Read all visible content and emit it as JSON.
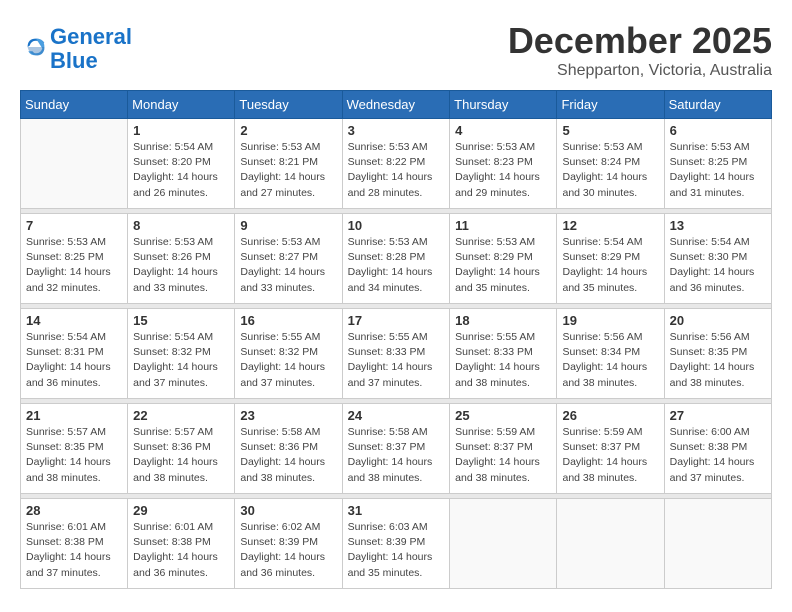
{
  "header": {
    "logo_line1": "General",
    "logo_line2": "Blue",
    "month": "December 2025",
    "location": "Shepparton, Victoria, Australia"
  },
  "calendar": {
    "days_of_week": [
      "Sunday",
      "Monday",
      "Tuesday",
      "Wednesday",
      "Thursday",
      "Friday",
      "Saturday"
    ],
    "weeks": [
      [
        {
          "day": "",
          "info": ""
        },
        {
          "day": "1",
          "info": "Sunrise: 5:54 AM\nSunset: 8:20 PM\nDaylight: 14 hours\nand 26 minutes."
        },
        {
          "day": "2",
          "info": "Sunrise: 5:53 AM\nSunset: 8:21 PM\nDaylight: 14 hours\nand 27 minutes."
        },
        {
          "day": "3",
          "info": "Sunrise: 5:53 AM\nSunset: 8:22 PM\nDaylight: 14 hours\nand 28 minutes."
        },
        {
          "day": "4",
          "info": "Sunrise: 5:53 AM\nSunset: 8:23 PM\nDaylight: 14 hours\nand 29 minutes."
        },
        {
          "day": "5",
          "info": "Sunrise: 5:53 AM\nSunset: 8:24 PM\nDaylight: 14 hours\nand 30 minutes."
        },
        {
          "day": "6",
          "info": "Sunrise: 5:53 AM\nSunset: 8:25 PM\nDaylight: 14 hours\nand 31 minutes."
        }
      ],
      [
        {
          "day": "7",
          "info": "Sunrise: 5:53 AM\nSunset: 8:25 PM\nDaylight: 14 hours\nand 32 minutes."
        },
        {
          "day": "8",
          "info": "Sunrise: 5:53 AM\nSunset: 8:26 PM\nDaylight: 14 hours\nand 33 minutes."
        },
        {
          "day": "9",
          "info": "Sunrise: 5:53 AM\nSunset: 8:27 PM\nDaylight: 14 hours\nand 33 minutes."
        },
        {
          "day": "10",
          "info": "Sunrise: 5:53 AM\nSunset: 8:28 PM\nDaylight: 14 hours\nand 34 minutes."
        },
        {
          "day": "11",
          "info": "Sunrise: 5:53 AM\nSunset: 8:29 PM\nDaylight: 14 hours\nand 35 minutes."
        },
        {
          "day": "12",
          "info": "Sunrise: 5:54 AM\nSunset: 8:29 PM\nDaylight: 14 hours\nand 35 minutes."
        },
        {
          "day": "13",
          "info": "Sunrise: 5:54 AM\nSunset: 8:30 PM\nDaylight: 14 hours\nand 36 minutes."
        }
      ],
      [
        {
          "day": "14",
          "info": "Sunrise: 5:54 AM\nSunset: 8:31 PM\nDaylight: 14 hours\nand 36 minutes."
        },
        {
          "day": "15",
          "info": "Sunrise: 5:54 AM\nSunset: 8:32 PM\nDaylight: 14 hours\nand 37 minutes."
        },
        {
          "day": "16",
          "info": "Sunrise: 5:55 AM\nSunset: 8:32 PM\nDaylight: 14 hours\nand 37 minutes."
        },
        {
          "day": "17",
          "info": "Sunrise: 5:55 AM\nSunset: 8:33 PM\nDaylight: 14 hours\nand 37 minutes."
        },
        {
          "day": "18",
          "info": "Sunrise: 5:55 AM\nSunset: 8:33 PM\nDaylight: 14 hours\nand 38 minutes."
        },
        {
          "day": "19",
          "info": "Sunrise: 5:56 AM\nSunset: 8:34 PM\nDaylight: 14 hours\nand 38 minutes."
        },
        {
          "day": "20",
          "info": "Sunrise: 5:56 AM\nSunset: 8:35 PM\nDaylight: 14 hours\nand 38 minutes."
        }
      ],
      [
        {
          "day": "21",
          "info": "Sunrise: 5:57 AM\nSunset: 8:35 PM\nDaylight: 14 hours\nand 38 minutes."
        },
        {
          "day": "22",
          "info": "Sunrise: 5:57 AM\nSunset: 8:36 PM\nDaylight: 14 hours\nand 38 minutes."
        },
        {
          "day": "23",
          "info": "Sunrise: 5:58 AM\nSunset: 8:36 PM\nDaylight: 14 hours\nand 38 minutes."
        },
        {
          "day": "24",
          "info": "Sunrise: 5:58 AM\nSunset: 8:37 PM\nDaylight: 14 hours\nand 38 minutes."
        },
        {
          "day": "25",
          "info": "Sunrise: 5:59 AM\nSunset: 8:37 PM\nDaylight: 14 hours\nand 38 minutes."
        },
        {
          "day": "26",
          "info": "Sunrise: 5:59 AM\nSunset: 8:37 PM\nDaylight: 14 hours\nand 38 minutes."
        },
        {
          "day": "27",
          "info": "Sunrise: 6:00 AM\nSunset: 8:38 PM\nDaylight: 14 hours\nand 37 minutes."
        }
      ],
      [
        {
          "day": "28",
          "info": "Sunrise: 6:01 AM\nSunset: 8:38 PM\nDaylight: 14 hours\nand 37 minutes."
        },
        {
          "day": "29",
          "info": "Sunrise: 6:01 AM\nSunset: 8:38 PM\nDaylight: 14 hours\nand 36 minutes."
        },
        {
          "day": "30",
          "info": "Sunrise: 6:02 AM\nSunset: 8:39 PM\nDaylight: 14 hours\nand 36 minutes."
        },
        {
          "day": "31",
          "info": "Sunrise: 6:03 AM\nSunset: 8:39 PM\nDaylight: 14 hours\nand 35 minutes."
        },
        {
          "day": "",
          "info": ""
        },
        {
          "day": "",
          "info": ""
        },
        {
          "day": "",
          "info": ""
        }
      ]
    ]
  }
}
